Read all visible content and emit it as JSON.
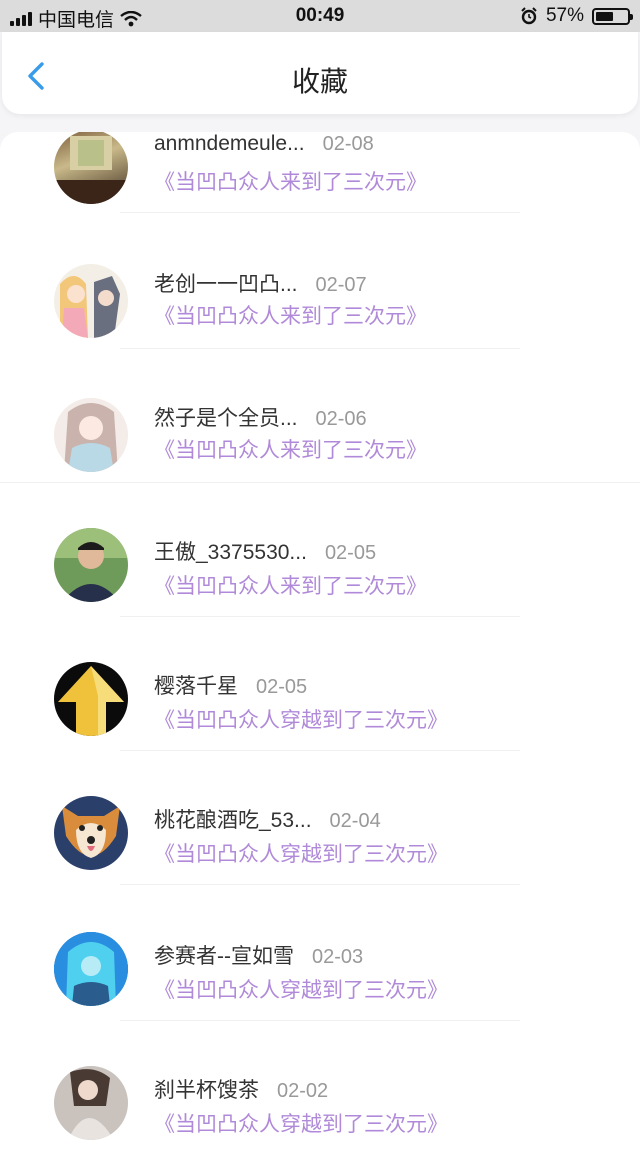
{
  "status_bar": {
    "carrier": "中国电信",
    "time": "00:49",
    "battery": "57%",
    "battery_level": 0.57
  },
  "header": {
    "title": "收藏",
    "back_icon": "chevron-left-icon",
    "accent_color": "#3a9be8"
  },
  "favorites": [
    {
      "user": "anmndemeule...",
      "date": "02-08",
      "book": "《当凹凸众人来到了三次元》"
    },
    {
      "user": "老创一一凹凸...",
      "date": "02-07",
      "book": "《当凹凸众人来到了三次元》"
    },
    {
      "user": "然子是个全员...",
      "date": "02-06",
      "book": "《当凹凸众人来到了三次元》"
    },
    {
      "user": "王傲_3375530...",
      "date": "02-05",
      "book": "《当凹凸众人来到了三次元》"
    },
    {
      "user": "樱落千星",
      "date": "02-05",
      "book": "《当凹凸众人穿越到了三次元》"
    },
    {
      "user": "桃花酿酒吃_53...",
      "date": "02-04",
      "book": "《当凹凸众人穿越到了三次元》"
    },
    {
      "user": "参赛者--宣如雪",
      "date": "02-03",
      "book": "《当凹凸众人穿越到了三次元》"
    },
    {
      "user": "刹半杯馊茶",
      "date": "02-02",
      "book": "《当凹凸众人穿越到了三次元》"
    }
  ],
  "colors": {
    "book_title": "#b08ad8",
    "date": "#999999",
    "username": "#333333"
  }
}
